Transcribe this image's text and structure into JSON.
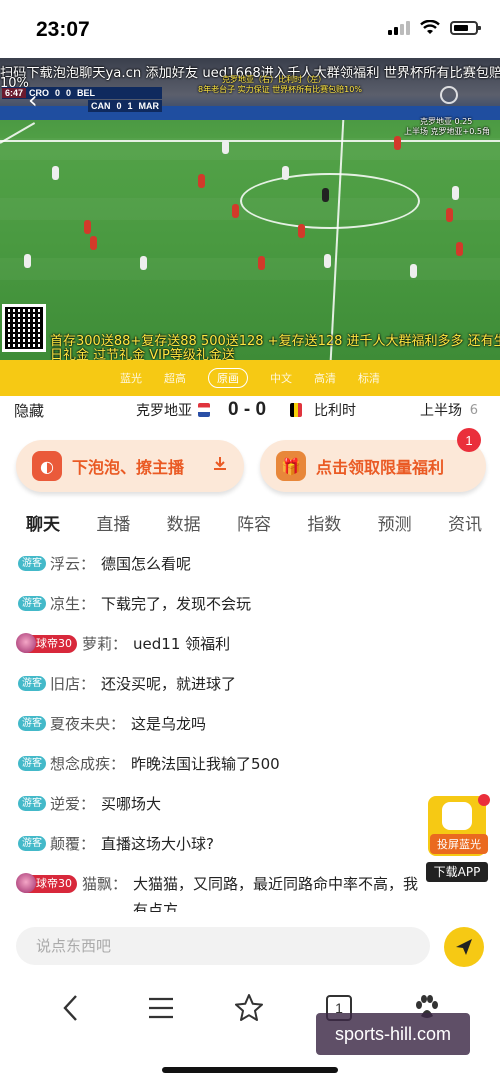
{
  "status": {
    "time": "23:07"
  },
  "video": {
    "overlay_top": "扫码下载泡泡聊天ya.cn 添加好友 ued1668进入千人大群领福利 世界杯所有比赛包赔",
    "overlay_top2": "10%",
    "overlay_ad1": "8年老台子 实力保证  世界杯所有比赛包赔10%",
    "overlay_ad2": "克罗地亚（右）比利时（左）",
    "overlay_right": "上半场 克罗地亚+0.5角",
    "overlay_right2": "克罗地亚 0.25",
    "overlay_bottom1": "首存300送88+复存送88 500送128 +复存送128 进千人大群福利多多 还有生",
    "overlay_bottom2": "日礼金 过节礼金 VIP等级礼金送",
    "scoreboard": {
      "time": "6:47",
      "home": "CRO",
      "home_score": "0",
      "away_score": "0",
      "away": "BEL",
      "other_home": "CAN",
      "other_home_score": "0",
      "other_away_score": "1",
      "other_away": "MAR"
    }
  },
  "quality": {
    "options": [
      "蓝光",
      "超高",
      "原画",
      "中文",
      "高清",
      "标清"
    ],
    "active": "原画"
  },
  "match": {
    "hide_label": "隐藏",
    "team_a": "克罗地亚",
    "score": "0 - 0",
    "team_b": "比利时",
    "period": "上半场",
    "period_num": "6"
  },
  "promos": {
    "left_label": "下泡泡、撩主播",
    "right_label": "点击领取限量福利",
    "right_badge": "1"
  },
  "tabs": [
    "聊天",
    "直播",
    "数据",
    "阵容",
    "指数",
    "预测",
    "资讯"
  ],
  "chat": [
    {
      "tag": "游客",
      "user": "浮云",
      "text": "德国怎么看呢"
    },
    {
      "tag": "游客",
      "user": "凉生",
      "text": "下载完了，发现不会玩"
    },
    {
      "tag": "球帝30",
      "user": "萝莉",
      "text": "ued11 领福利"
    },
    {
      "tag": "游客",
      "user": "旧店",
      "text": "还没买呢，就进球了"
    },
    {
      "tag": "游客",
      "user": "夏夜未央",
      "text": "这是乌龙吗"
    },
    {
      "tag": "游客",
      "user": "想念成疾",
      "text": "昨晚法国让我输了500"
    },
    {
      "tag": "游客",
      "user": "逆爱",
      "text": "买哪场大"
    },
    {
      "tag": "游客",
      "user": "颠覆",
      "text": "直播这场大小球?"
    },
    {
      "tag": "球帝30",
      "user": "猫飘",
      "text": "大猫猫，又同路，最近同路命中率不高，我有点方"
    }
  ],
  "float_app": {
    "label": "投屏蓝光",
    "download": "下载APP"
  },
  "input": {
    "placeholder": "说点东西吧"
  },
  "browser": {
    "tab_count": "1"
  },
  "watermark": "sports-hill.com"
}
